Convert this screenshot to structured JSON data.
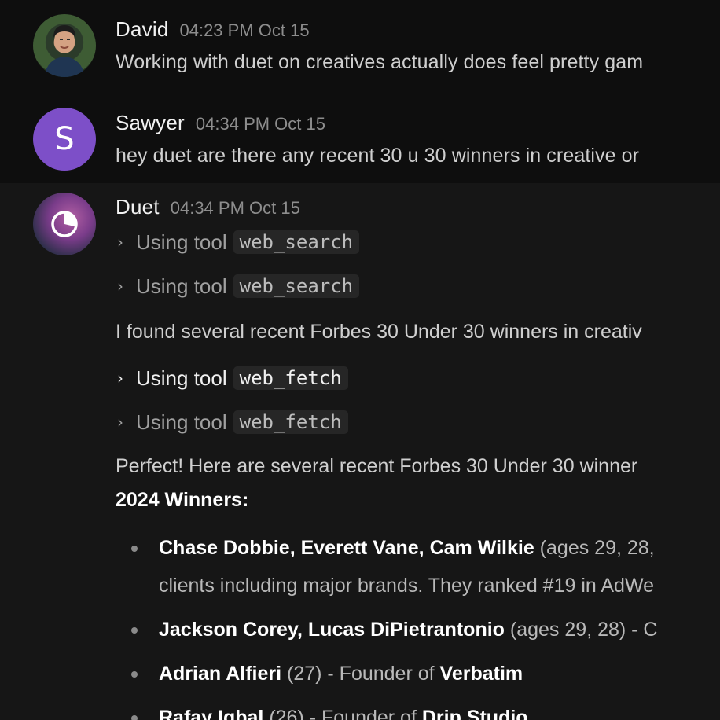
{
  "messages": {
    "david": {
      "author": "David",
      "time": "04:23 PM Oct 15",
      "text": "Working with duet on creatives actually does feel pretty gam"
    },
    "sawyer": {
      "author": "Sawyer",
      "avatar_letter": "S",
      "avatar_color": "#7d4fc8",
      "time": "04:34 PM Oct 15",
      "text": "hey duet are there any recent 30 u 30 winners in creative or"
    },
    "duet": {
      "author": "Duet",
      "time": "04:34 PM Oct 15",
      "tools": [
        {
          "label": "Using tool",
          "name": "web_search"
        },
        {
          "label": "Using tool",
          "name": "web_search"
        },
        {
          "label": "Using tool",
          "name": "web_fetch"
        },
        {
          "label": "Using tool",
          "name": "web_fetch"
        }
      ],
      "paragraph_1": "I found several recent Forbes 30 Under 30 winners in creativ",
      "paragraph_2": "Perfect! Here are several recent Forbes 30 Under 30 winner",
      "section_heading": "2024 Winners:",
      "winners": [
        {
          "names": "Chase Dobbie, Everett Vane, Cam Wilkie",
          "rest": " (ages 29, 28,",
          "continuation": "clients including major brands. They ranked #19 in AdWe"
        },
        {
          "names": "Jackson Corey, Lucas DiPietrantonio",
          "rest": " (ages 29, 28) - C"
        },
        {
          "names": "Adrian Alfieri",
          "rest": " (27) - Founder of ",
          "company": "Verbatim"
        },
        {
          "names": "Rafay Iqbal",
          "rest": " (26) - Founder of ",
          "company": "Drip Studio"
        }
      ]
    }
  },
  "icons": {
    "david_avatar": "user-photo",
    "duet_avatar": "duet-logo-icon",
    "tool_chevron": "chevron-right-icon"
  }
}
